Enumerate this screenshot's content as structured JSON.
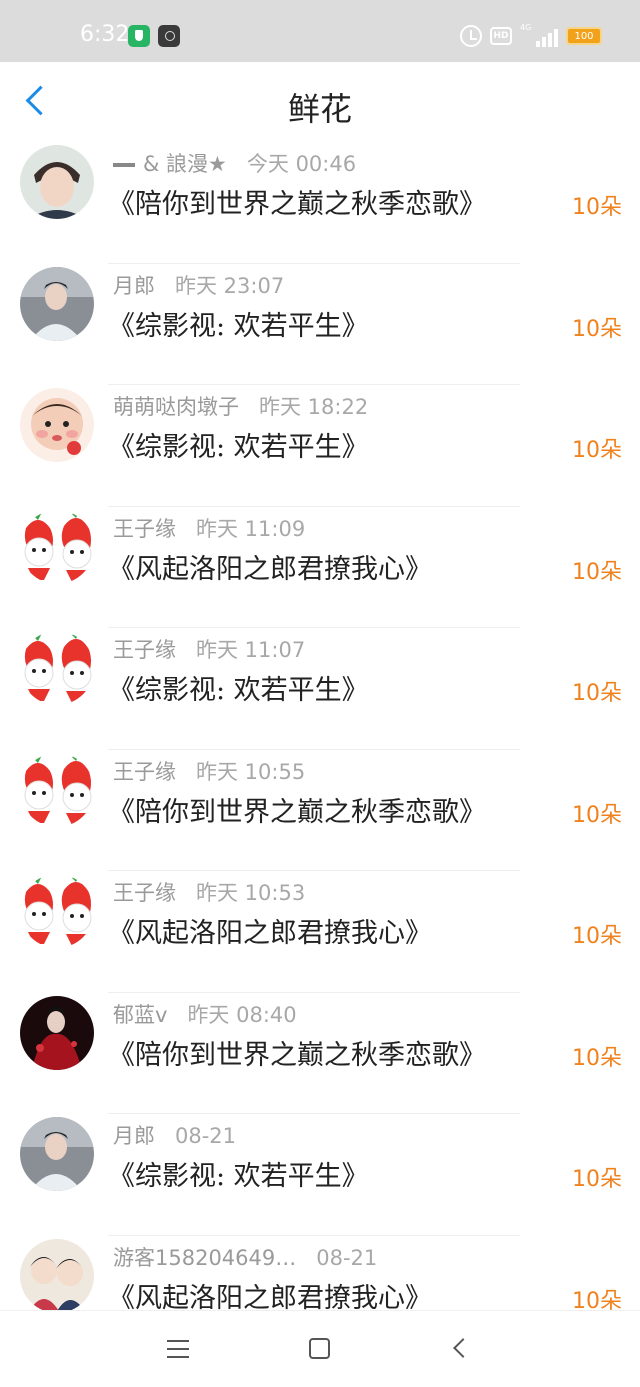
{
  "status_bar": {
    "time": "6:32",
    "hd_label": "HD",
    "network_label": "4G",
    "battery": "100"
  },
  "header": {
    "title": "鲜花"
  },
  "items": [
    {
      "name": "& 誏漫★",
      "time": "今天 00:46",
      "book": "《陪你到世界之巅之秋季恋歌》",
      "count": "10朵",
      "avatar": "boy-portrait"
    },
    {
      "name": "月郎",
      "time": "昨天 23:07",
      "book": "《综影视: 欢若平生》",
      "count": "10朵",
      "avatar": "costume-portrait"
    },
    {
      "name": "萌萌哒肉墩子",
      "time": "昨天 18:22",
      "book": "《综影视: 欢若平生》",
      "count": "10朵",
      "avatar": "baby-photo"
    },
    {
      "name": "王子缘",
      "time": "昨天 11:09",
      "book": "《风起洛阳之郎君撩我心》",
      "count": "10朵",
      "avatar": "strawberry-cartoon"
    },
    {
      "name": "王子缘",
      "time": "昨天 11:07",
      "book": "《综影视: 欢若平生》",
      "count": "10朵",
      "avatar": "strawberry-cartoon"
    },
    {
      "name": "王子缘",
      "time": "昨天 10:55",
      "book": "《陪你到世界之巅之秋季恋歌》",
      "count": "10朵",
      "avatar": "strawberry-cartoon"
    },
    {
      "name": "王子缘",
      "time": "昨天 10:53",
      "book": "《风起洛阳之郎君撩我心》",
      "count": "10朵",
      "avatar": "strawberry-cartoon"
    },
    {
      "name": "郁蓝v",
      "time": "昨天 08:40",
      "book": "《陪你到世界之巅之秋季恋歌》",
      "count": "10朵",
      "avatar": "red-costume-portrait"
    },
    {
      "name": "月郎",
      "time": "08-21",
      "book": "《综影视: 欢若平生》",
      "count": "10朵",
      "avatar": "costume-portrait"
    },
    {
      "name": "游客158204649…",
      "time": "08-21",
      "book": "《风起洛阳之郎君撩我心》",
      "count": "10朵",
      "avatar": "couple-cartoon"
    }
  ],
  "colors": {
    "accent_blue": "#1a8be6",
    "flower_count": "#f0821e",
    "status_bar_bg": "#dcdcdc"
  },
  "nav": {
    "menu_icon": "menu-icon",
    "home_icon": "home-icon",
    "back_icon": "back-icon"
  }
}
